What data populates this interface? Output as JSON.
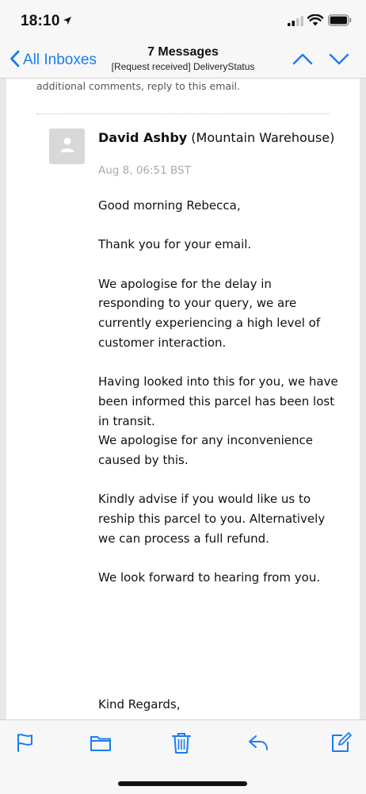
{
  "status_bar": {
    "time": "18:10",
    "icons": [
      "location-arrow-icon",
      "signal-icon",
      "wifi-icon",
      "battery-icon"
    ]
  },
  "nav": {
    "back_label": "All Inboxes",
    "title": "7 Messages",
    "subtitle": "[Request received] DeliveryStatus",
    "icons": [
      "chevron-left-icon",
      "chevron-up-icon",
      "chevron-down-icon"
    ]
  },
  "previous_message": {
    "tail_text": "additional comments, reply to this email."
  },
  "message": {
    "sender_name": "David Ashby",
    "sender_org": "(Mountain Warehouse)",
    "date": "Aug 8, 06:51 BST",
    "body": {
      "greeting": "Good morning Rebecca,",
      "p1": "Thank you for your email.",
      "p2": "We apologise for the delay in responding to your query, we are currently experiencing a high level of customer interaction.",
      "p3": "Having looked into this for you, we have been informed this parcel has been lost in transit.",
      "p3b": "We apologise for any inconvenience caused by this.",
      "p4": "Kindly advise if you would like us to reship this parcel to you. Alternatively we can process a full refund.",
      "p5": "We look forward to hearing from you."
    },
    "closing": "Kind Regards,"
  },
  "toolbar": {
    "icons": [
      "flag-icon",
      "folder-icon",
      "trash-icon",
      "reply-icon",
      "compose-icon"
    ]
  },
  "colors": {
    "accent": "#1a7cf3",
    "bar_background": "#f7f7f7",
    "date_gray": "#aaaaaa"
  }
}
